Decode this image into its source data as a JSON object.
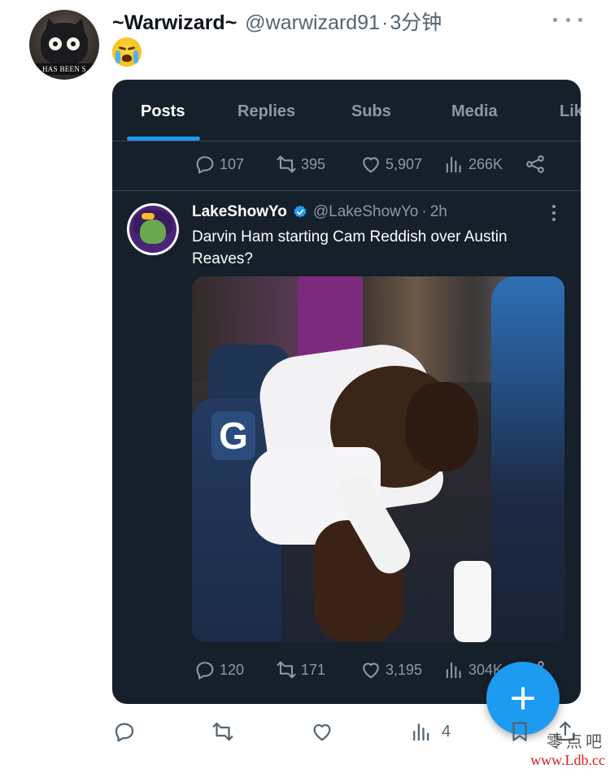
{
  "post": {
    "author_name": "~Warwizard~",
    "handle": "@warwizard91",
    "separator": "·",
    "time": "3分钟",
    "emoji_name": "loudly-crying-face-emoji",
    "avatar_caption": "HAS BEEN S",
    "actions": {
      "views": "4"
    }
  },
  "screenshot": {
    "tabs": [
      {
        "label": "Posts",
        "active": true
      },
      {
        "label": "Replies",
        "active": false
      },
      {
        "label": "Subs",
        "active": false
      },
      {
        "label": "Media",
        "active": false
      },
      {
        "label": "Lik",
        "active": false
      }
    ],
    "prev_tweet_stats": {
      "replies": "107",
      "reposts": "395",
      "likes": "5,907",
      "views": "266K"
    },
    "tweet": {
      "author_name": "LakeShowYo",
      "handle": "@LakeShowYo",
      "separator": "·",
      "time": "2h",
      "text": "Darvin Ham starting Cam Reddish over Austin Reaves?",
      "media_logo": "G",
      "stats": {
        "replies": "120",
        "reposts": "171",
        "likes": "3,195",
        "views": "304K"
      }
    }
  },
  "watermark": {
    "chinese": "零点吧",
    "url": "www.Ldb.cc"
  },
  "colors": {
    "accent": "#1d9bf0",
    "dark_bg": "#15202b",
    "muted_dark": "#8b98a5",
    "muted_light": "#536471",
    "watermark_red": "#d22020"
  }
}
